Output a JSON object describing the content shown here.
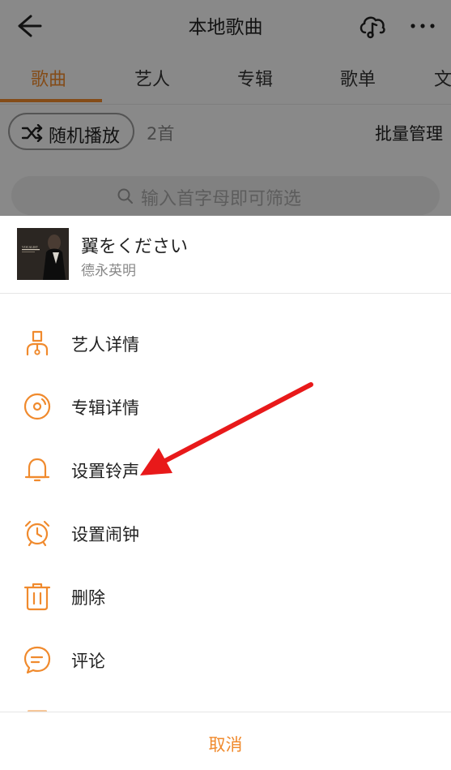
{
  "header": {
    "title": "本地歌曲",
    "back_icon": "arrow-left-icon",
    "cloud_icon": "cloud-music-icon",
    "more_icon": "more-dots-icon"
  },
  "tabs": [
    {
      "label": "歌曲",
      "active": true
    },
    {
      "label": "艺人",
      "active": false
    },
    {
      "label": "专辑",
      "active": false
    },
    {
      "label": "歌单",
      "active": false
    },
    {
      "label": "文",
      "active": false
    }
  ],
  "toolbar": {
    "shuffle_label": "随机播放",
    "count": "2首",
    "batch_label": "批量管理"
  },
  "search": {
    "placeholder": "输入首字母即可筛选"
  },
  "sheet": {
    "song_title": "翼をください",
    "song_artist": "德永英明",
    "cover_text": "VOCALIST",
    "menu": [
      {
        "label": "艺人详情",
        "icon": "artist-icon"
      },
      {
        "label": "专辑详情",
        "icon": "album-disc-icon"
      },
      {
        "label": "设置铃声",
        "icon": "bell-icon"
      },
      {
        "label": "设置闹钟",
        "icon": "alarm-clock-icon"
      },
      {
        "label": "删除",
        "icon": "trash-icon"
      },
      {
        "label": "评论",
        "icon": "comment-icon"
      }
    ],
    "cancel_label": "取消"
  },
  "colors": {
    "accent": "#f08a2d",
    "arrow": "#e8191a"
  }
}
